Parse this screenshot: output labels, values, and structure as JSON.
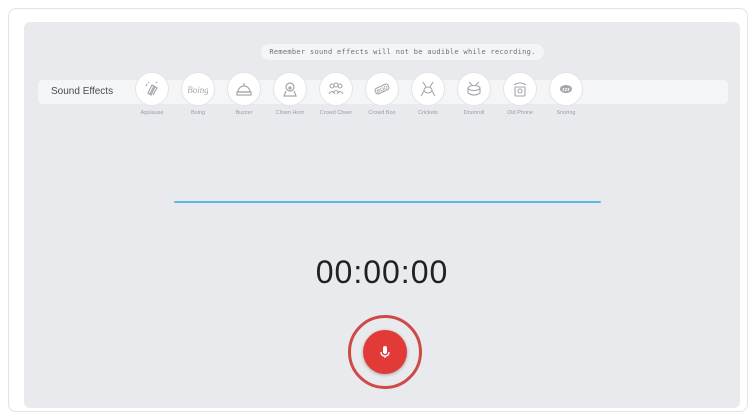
{
  "notice": "Remember sound effects will not be audible while recording.",
  "sound_effects": {
    "title": "Sound Effects",
    "items": [
      {
        "label": "Applause",
        "icon": "applause-icon"
      },
      {
        "label": "Boing",
        "icon": "boing-icon"
      },
      {
        "label": "Buzzer",
        "icon": "buzzer-icon"
      },
      {
        "label": "Clown Horn",
        "icon": "clown-horn-icon"
      },
      {
        "label": "Crowd Cheer",
        "icon": "crowd-cheer-icon"
      },
      {
        "label": "Crowd Boo",
        "icon": "crowd-boo-icon"
      },
      {
        "label": "Crickets",
        "icon": "crickets-icon"
      },
      {
        "label": "Drumroll",
        "icon": "drumroll-icon"
      },
      {
        "label": "Old Phone",
        "icon": "old-phone-icon"
      },
      {
        "label": "Snoring",
        "icon": "snoring-icon"
      }
    ]
  },
  "timer": "00:00:00",
  "record": {
    "icon": "microphone-icon"
  },
  "colors": {
    "accent_line": "#5fb6e2",
    "record_red": "#e23b37",
    "ring_red": "#cf4a47",
    "panel_bg": "#e9eaee"
  }
}
